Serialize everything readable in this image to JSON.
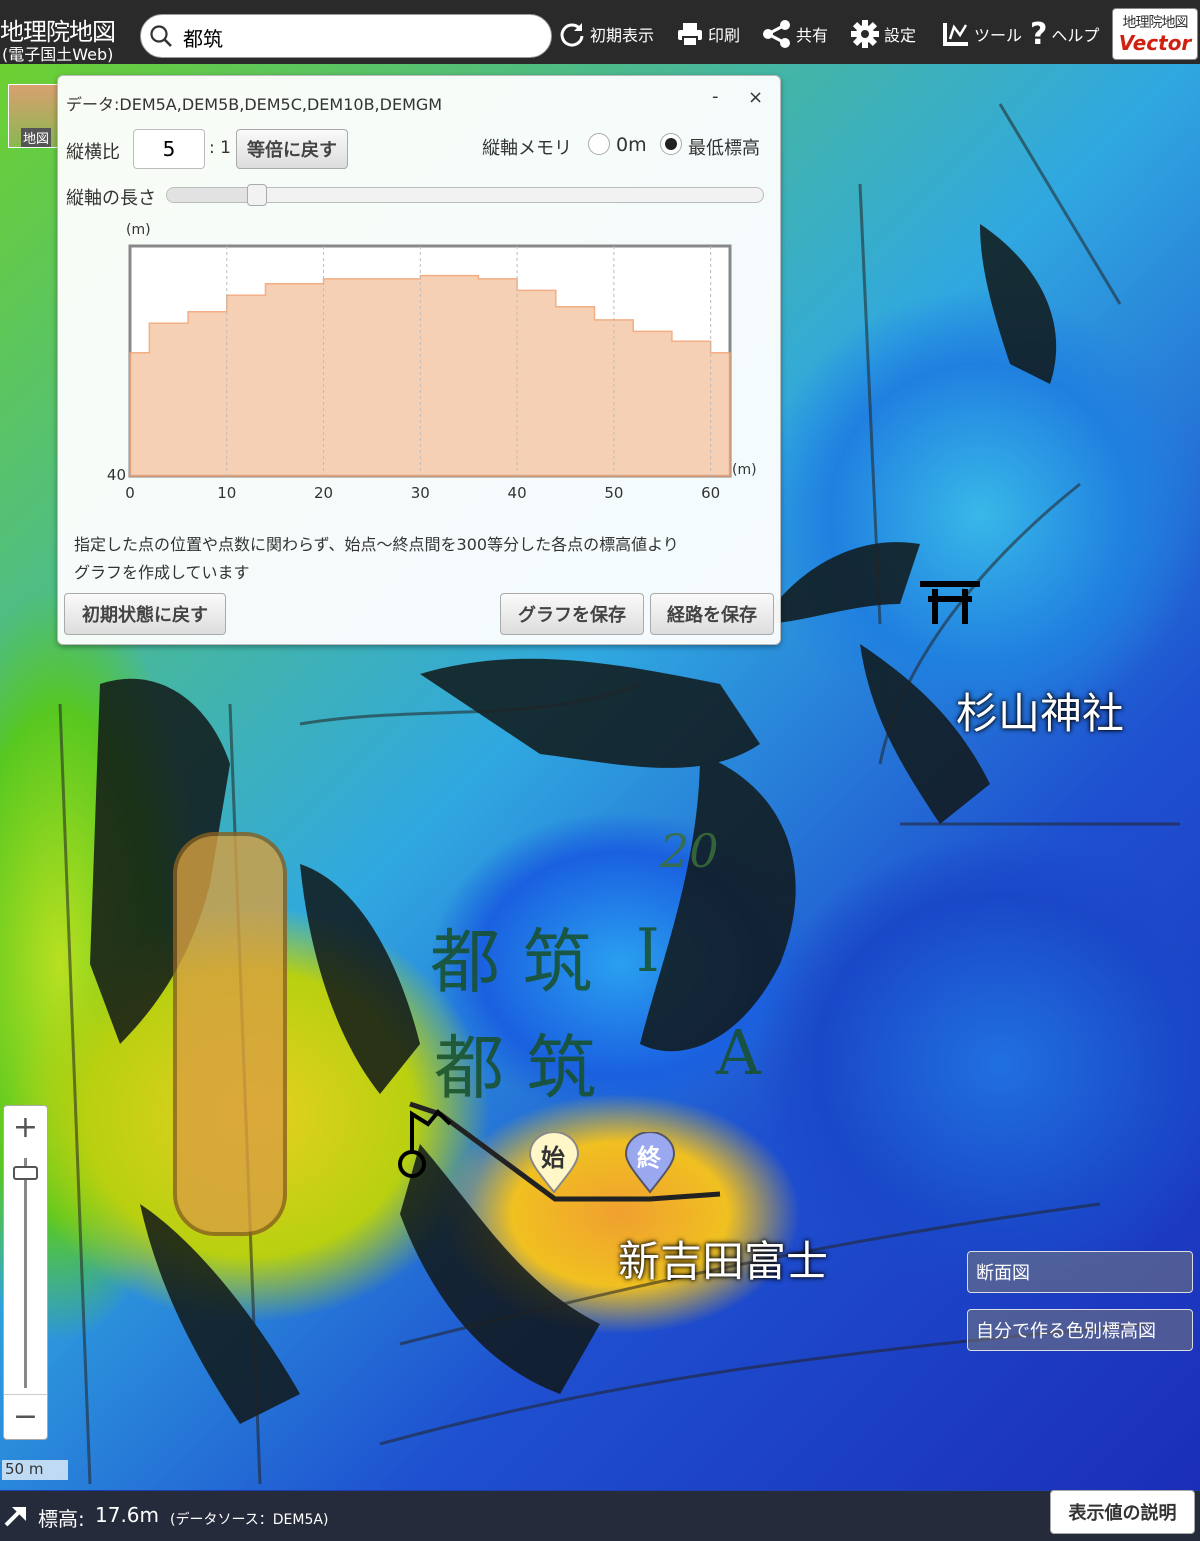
{
  "header": {
    "logo_main": "地理院地図",
    "logo_sub": "(電子国土Web)",
    "search_value": "都筑",
    "tools": [
      {
        "label": "初期表示",
        "icon": "reload-icon"
      },
      {
        "label": "印刷",
        "icon": "printer-icon"
      },
      {
        "label": "共有",
        "icon": "share-icon"
      },
      {
        "label": "設定",
        "icon": "gear-icon"
      },
      {
        "label": "ツール",
        "icon": "tools-icon"
      },
      {
        "label": "ヘルプ",
        "icon": "help-icon"
      }
    ],
    "vector_top": "地理院地図",
    "vector_bottom": "Vector"
  },
  "panel": {
    "title": "データ:DEM5A,DEM5B,DEM5C,DEM10B,DEMGM",
    "minimize": "-",
    "close": "×",
    "ratio_label": "縦横比",
    "ratio_value": "5",
    "ratio_suffix": ": 1",
    "reset_ratio_button": "等倍に戻す",
    "axis_memory_label": "縦軸メモリ",
    "radio_zero": "0m",
    "radio_min": "最低標高",
    "axis_length_label": "縦軸の長さ",
    "slider_value": 0.15,
    "note_line1": "指定した点の位置や点数に関わらず、始点〜終点間を300等分した各点の標高値より",
    "note_line2": "グラフを作成しています",
    "reset_button": "初期状態に戻す",
    "save_graph_button": "グラフを保存",
    "save_route_button": "経路を保存"
  },
  "chart_data": {
    "type": "area",
    "xlabel": "(m)",
    "ylabel": "(m)",
    "xlim": [
      0,
      62
    ],
    "ylim": [
      40,
      41.4
    ],
    "xticks": [
      "0",
      "10",
      "20",
      "30",
      "40",
      "50",
      "60"
    ],
    "yticks": [
      "40"
    ],
    "x": [
      0,
      2,
      6,
      10,
      14,
      20,
      30,
      36,
      40,
      44,
      48,
      52,
      56,
      60,
      62
    ],
    "y": [
      40.75,
      40.93,
      41.0,
      41.1,
      41.17,
      41.2,
      41.22,
      41.2,
      41.13,
      41.03,
      40.95,
      40.88,
      40.82,
      40.75,
      40.75
    ],
    "fill_color": "#f5c8a8",
    "line_color": "#f0a070"
  },
  "map": {
    "labels": [
      {
        "text": "杉山神社",
        "kind": "place"
      },
      {
        "text": "新吉田富士",
        "kind": "place"
      },
      {
        "text": "都 筑",
        "kind": "kanji"
      },
      {
        "text": "都 筑",
        "kind": "kanji"
      },
      {
        "text": "20",
        "kind": "contour"
      },
      {
        "text": "I",
        "kind": "kanji"
      },
      {
        "text": "A",
        "kind": "kanji"
      }
    ],
    "start_marker": "始",
    "end_marker": "終",
    "thumb_label": "地図",
    "scale_label": "50 m"
  },
  "side": {
    "profile_button": "断面図",
    "color_elev_button": "自分で作る色別標高図"
  },
  "footer": {
    "elev_label": "標高:",
    "elev_value": "17.6m",
    "elev_source": "(データソース：DEM5A)",
    "explain_button": "表示値の説明"
  },
  "colors": {
    "header_bg": "#2a2a2a",
    "start_marker": "#fff7c8",
    "end_marker": "#9aa8f0",
    "vector_red": "#d02010"
  }
}
